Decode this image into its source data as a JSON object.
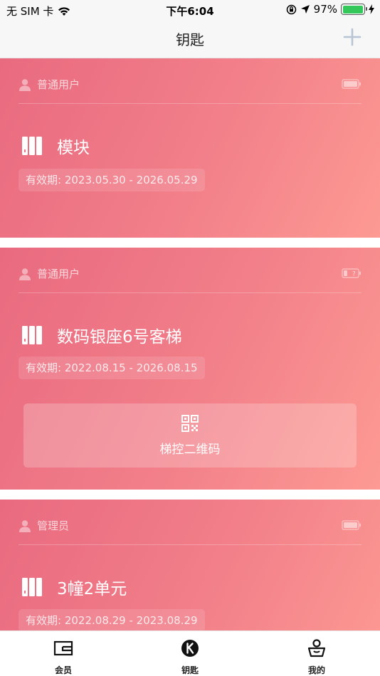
{
  "status_bar": {
    "carrier": "无 SIM 卡",
    "time": "下午6:04",
    "battery_percent": "97%",
    "battery_level": 0.97,
    "icons": [
      "wifi-icon",
      "orientation-lock-icon",
      "location-arrow-icon",
      "charging-bolt-icon"
    ]
  },
  "nav": {
    "title": "钥匙",
    "add_icon": "plus-icon"
  },
  "cards": [
    {
      "role": "普通用户",
      "title": "模块",
      "validity_label": "有效期:",
      "validity_range": "2023.05.30 - 2026.05.29",
      "battery_icon": "device-battery-icon"
    },
    {
      "role": "普通用户",
      "title": "数码银座6号客梯",
      "validity_label": "有效期:",
      "validity_range": "2022.08.15 - 2026.08.15",
      "battery_icon": "device-battery-unknown-icon",
      "qr_label": "梯控二维码"
    },
    {
      "role": "管理员",
      "title": "3幢2单元",
      "validity_label": "有效期:",
      "validity_range": "2022.08.29 - 2023.08.29",
      "battery_icon": "device-battery-icon"
    }
  ],
  "tabs": [
    {
      "label": "会员",
      "icon": "card-icon"
    },
    {
      "label": "钥匙",
      "icon": "key-logo-icon"
    },
    {
      "label": "我的",
      "icon": "user-basket-icon"
    }
  ],
  "colors": {
    "card_gradient_start": "#e96a7f",
    "card_gradient_end": "#fd9a93",
    "nav_background": "#f7f7f7",
    "accent_plus": "#b7c4d4",
    "battery_green": "#34c759"
  }
}
